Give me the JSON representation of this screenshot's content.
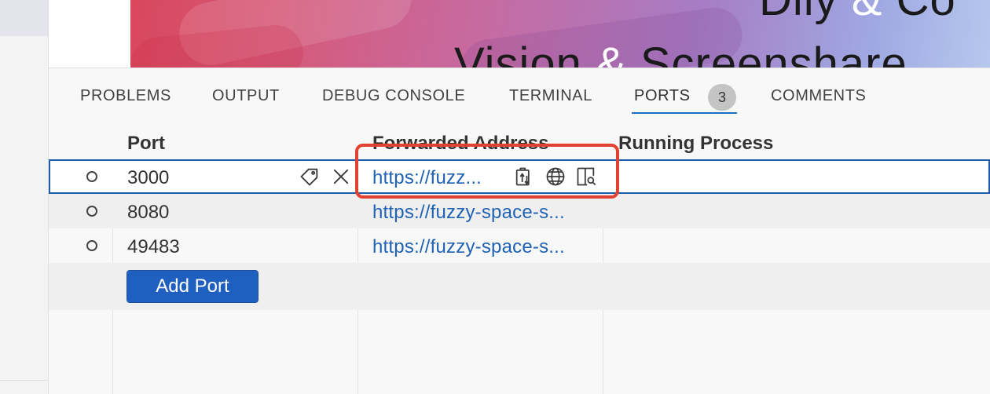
{
  "banner": {
    "line1_left": "Dily",
    "line1_amp": "&",
    "line1_right": "Co",
    "line2_left": "Vision",
    "line2_amp": "&",
    "line2_right": "Screenshare"
  },
  "panel": {
    "tabs": [
      {
        "label": "PROBLEMS"
      },
      {
        "label": "OUTPUT"
      },
      {
        "label": "DEBUG CONSOLE"
      },
      {
        "label": "TERMINAL"
      },
      {
        "label": "PORTS",
        "badge": "3",
        "active": true
      },
      {
        "label": "COMMENTS"
      }
    ]
  },
  "ports_table": {
    "headers": {
      "port": "Port",
      "forwarded_address": "Forwarded Address",
      "running_process": "Running Process"
    },
    "rows": [
      {
        "port": "3000",
        "address": "https://fuzz...",
        "process": "",
        "selected": true
      },
      {
        "port": "8080",
        "address": "https://fuzzy-space-s...",
        "process": ""
      },
      {
        "port": "49483",
        "address": "https://fuzzy-space-s...",
        "process": ""
      }
    ],
    "add_port_label": "Add Port"
  },
  "icons": {
    "row_actions": [
      "tag-icon",
      "close-icon"
    ],
    "address_actions": [
      "copy-address-icon",
      "globe-icon",
      "preview-in-editor-icon"
    ],
    "status": "circle-outline-icon"
  },
  "colors": {
    "accent": "#1f5fbf",
    "link": "#1f62b3",
    "selection_border": "#1e5ba8",
    "highlight_annotation": "#e3412f",
    "badge_bg": "#c4c4c4"
  }
}
